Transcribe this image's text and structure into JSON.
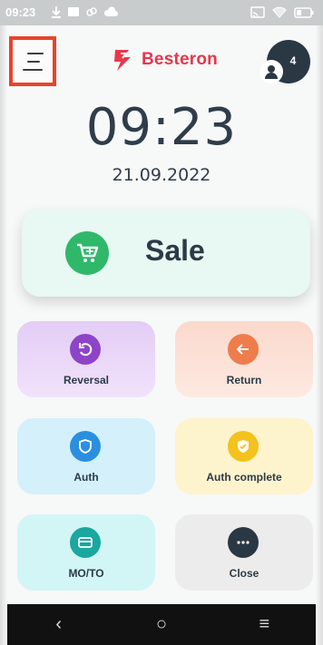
{
  "status_bar": {
    "time": "09:23",
    "left_icons": [
      "download-icon",
      "image-icon",
      "link-icon",
      "cloud-icon"
    ],
    "right_icons": [
      "cast-icon",
      "wifi-icon",
      "battery-icon"
    ]
  },
  "header": {
    "brand_name": "Besteron",
    "brand_color": "#e8374c",
    "user_badge_count": "4"
  },
  "clock": {
    "time": "09:23",
    "date": "21.09.2022"
  },
  "sale": {
    "label": "Sale",
    "icon": "cart-icon",
    "icon_color": "#2fb86a"
  },
  "tiles": [
    {
      "label": "Reversal",
      "icon": "undo-icon",
      "icon_color": "#8e44c9"
    },
    {
      "label": "Return",
      "icon": "arrow-left-icon",
      "icon_color": "#ee7d4b"
    },
    {
      "label": "Auth",
      "icon": "shield-icon",
      "icon_color": "#2b8fe0"
    },
    {
      "label": "Auth complete",
      "icon": "shield-check-icon",
      "icon_color": "#f4c21c"
    },
    {
      "label": "MO/TO",
      "icon": "card-icon",
      "icon_color": "#19a7a0"
    },
    {
      "label": "Close",
      "icon": "more-icon",
      "icon_color": "#2a3844"
    }
  ],
  "nav": {
    "back_glyph": "‹",
    "home_glyph": "○",
    "recents_glyph": "≡"
  }
}
